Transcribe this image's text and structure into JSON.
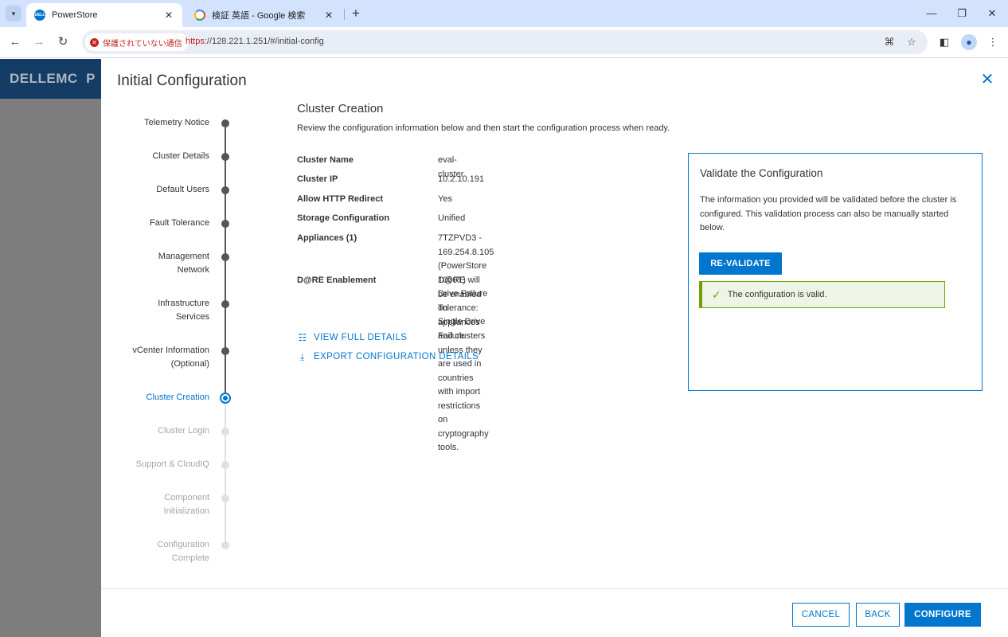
{
  "browser": {
    "tabs": [
      {
        "title": "PowerStore",
        "favicon": "dell-icon",
        "close": "✕"
      },
      {
        "title": "検証 英語 - Google 検索",
        "favicon": "google-icon",
        "close": "✕"
      }
    ],
    "new_tab": "+",
    "window_controls": {
      "minimize": "—",
      "restore": "❐",
      "close": "✕"
    },
    "security_label": "保護されていない通信",
    "url_scheme": "https",
    "url_rest": "://128.221.1.251/#/initial-config"
  },
  "background_app": {
    "logo": "DELLEMC",
    "product_initial": "P"
  },
  "modal": {
    "title": "Initial Configuration",
    "close_glyph": "✕",
    "steps": [
      {
        "label": "Telemetry Notice",
        "state": "done"
      },
      {
        "label": "Cluster Details",
        "state": "done"
      },
      {
        "label": "Default Users",
        "state": "done"
      },
      {
        "label": "Fault Tolerance",
        "state": "done"
      },
      {
        "label": "Management Network",
        "state": "done"
      },
      {
        "label": "Infrastructure Services",
        "state": "done"
      },
      {
        "label": "vCenter Information (Optional)",
        "state": "done"
      },
      {
        "label": "Cluster Creation",
        "state": "current"
      },
      {
        "label": "Cluster Login",
        "state": "future"
      },
      {
        "label": "Support & CloudIQ",
        "state": "future"
      },
      {
        "label": "Component Initialization",
        "state": "future"
      },
      {
        "label": "Configuration Complete",
        "state": "future"
      }
    ],
    "content": {
      "title": "Cluster Creation",
      "description": "Review the configuration information below and then start the configuration process when ready.",
      "details": [
        {
          "label": "Cluster Name",
          "value": "eval-cluster"
        },
        {
          "label": "Cluster IP",
          "value": "10.2.10.191"
        },
        {
          "label": "Allow HTTP Redirect",
          "value": "Yes"
        },
        {
          "label": "Storage Configuration",
          "value": "Unified"
        },
        {
          "label": "Appliances (1)",
          "value_line1": "7TZPVD3 - 169.254.8.105 (PowerStore 1000T)",
          "value_line2": "Drive Failure Tolerance: Single Drive Failure"
        },
        {
          "label": "D@RE Enablement",
          "value_line1": "D@RE will be enabled on appliances and clusters",
          "value_line2": "unless they are used in countries with import",
          "value_line3": "restrictions on cryptography tools."
        }
      ],
      "view_full_details": "VIEW FULL DETAILS",
      "export_details": "EXPORT CONFIGURATION DETAILS"
    },
    "validate": {
      "title": "Validate the Configuration",
      "text": "The information you provided will be validated before the cluster is configured. This validation process can also be manually started below.",
      "button": "RE-VALIDATE",
      "status": "The configuration is valid.",
      "status_color": "#6ea204"
    },
    "footer": {
      "cancel": "CANCEL",
      "back": "BACK",
      "configure": "CONFIGURE"
    },
    "accent_color": "#0076ce"
  }
}
